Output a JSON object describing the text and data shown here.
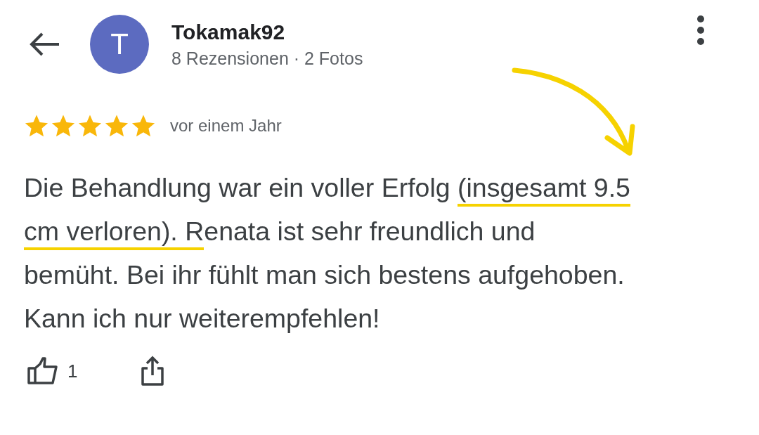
{
  "author": {
    "initial": "T",
    "name": "Tokamak92",
    "meta": "8 Rezensionen · 2 Fotos"
  },
  "review": {
    "stars": 5,
    "time": "vor einem Jahr",
    "text_parts": [
      {
        "text": "Die Behandlung war ein voller Erfolg ",
        "highlighted": false
      },
      {
        "text": "(insgesamt 9.5 cm verloren). R",
        "highlighted": true
      },
      {
        "text": "enata ist sehr freundlich und bemüht. Bei ihr fühlt man sich bestens aufgehoben. Kann ich nur weiterempfehlen!",
        "highlighted": false
      }
    ]
  },
  "actions": {
    "likes": "1"
  }
}
